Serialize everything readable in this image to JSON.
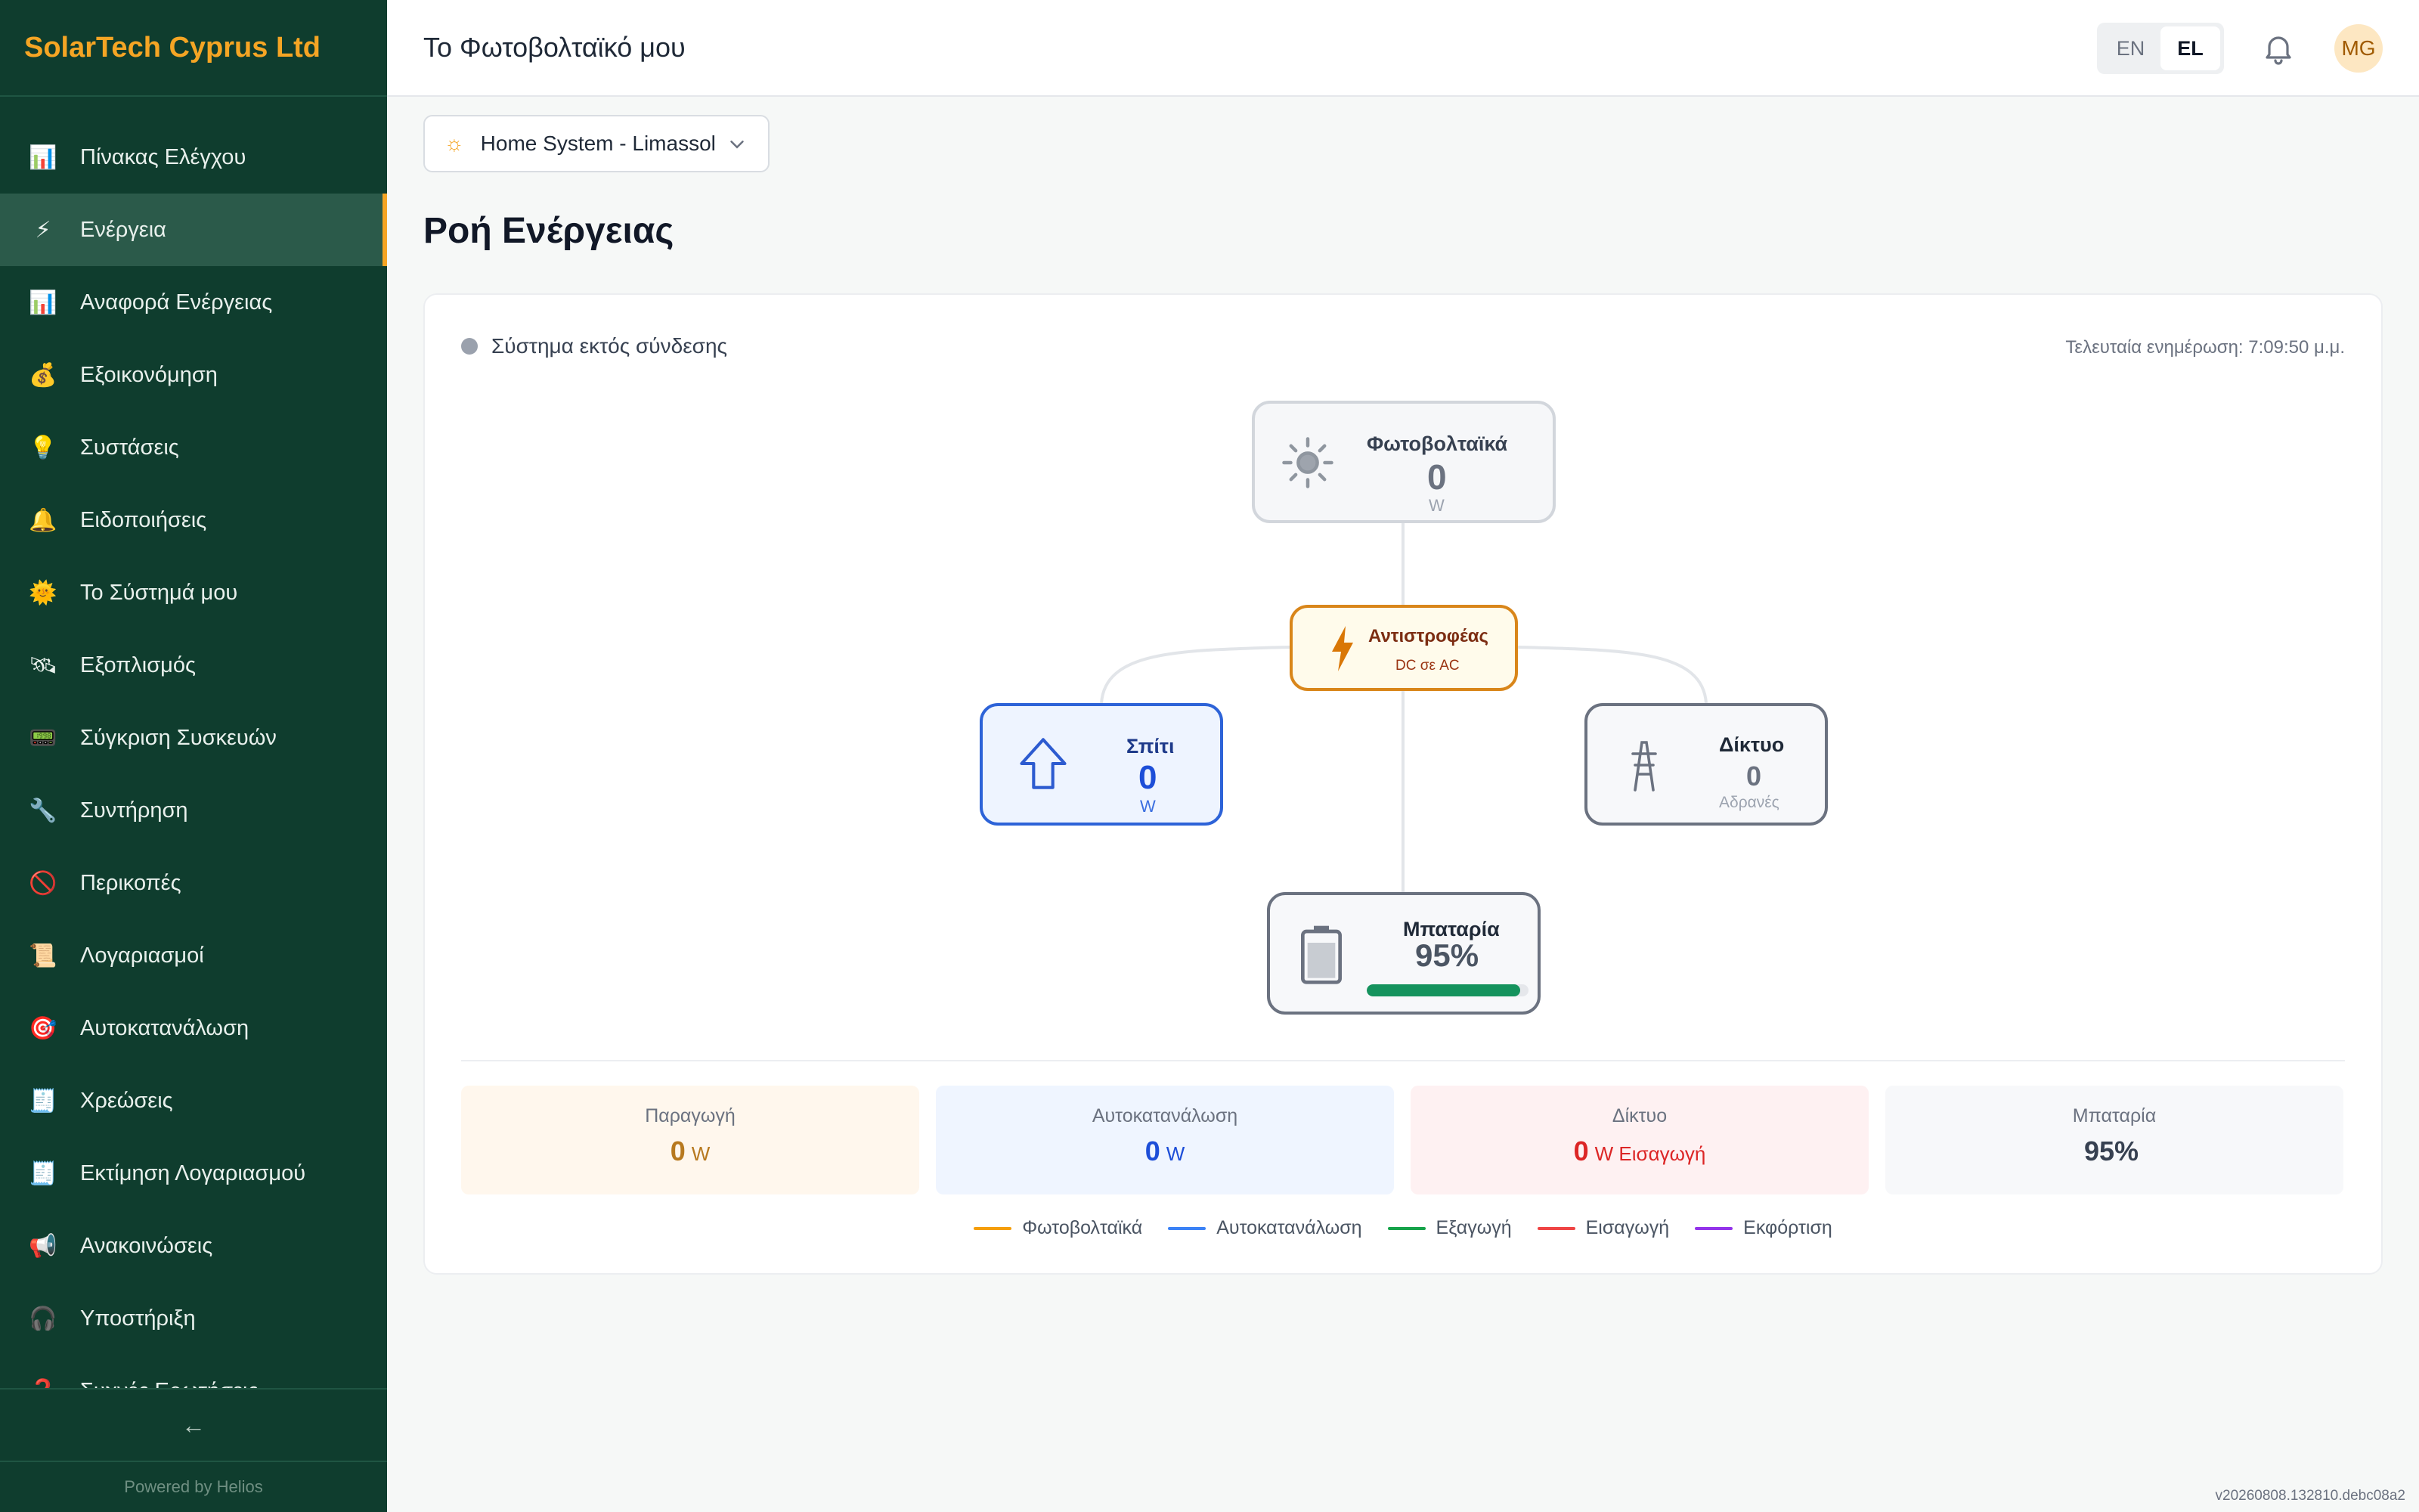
{
  "brand": "SolarTech Cyprus Ltd",
  "sidebar": {
    "items": [
      {
        "label": "Πίνακας Ελέγχου",
        "icon": "bar-chart-icon",
        "glyph": "📊"
      },
      {
        "label": "Ενέργεια",
        "icon": "lightning-icon",
        "glyph": "⚡",
        "active": true
      },
      {
        "label": "Αναφορά Ενέργειας",
        "icon": "report-icon",
        "glyph": "📊"
      },
      {
        "label": "Εξοικονόμηση",
        "icon": "money-bag-icon",
        "glyph": "💰"
      },
      {
        "label": "Συστάσεις",
        "icon": "lightbulb-icon",
        "glyph": "💡"
      },
      {
        "label": "Ειδοποιήσεις",
        "icon": "bell-icon",
        "glyph": "🔔"
      },
      {
        "label": "Το Σύστημά μου",
        "icon": "sun-icon",
        "glyph": "🌞"
      },
      {
        "label": "Εξοπλισμός",
        "icon": "satellite-icon",
        "glyph": "🛰"
      },
      {
        "label": "Σύγκριση Συσκευών",
        "icon": "device-icon",
        "glyph": "📟"
      },
      {
        "label": "Συντήρηση",
        "icon": "wrench-icon",
        "glyph": "🔧"
      },
      {
        "label": "Περικοπές",
        "icon": "prohibited-icon",
        "glyph": "🚫"
      },
      {
        "label": "Λογαριασμοί",
        "icon": "scroll-icon",
        "glyph": "📜"
      },
      {
        "label": "Αυτοκατανάλωση",
        "icon": "target-icon",
        "glyph": "🎯"
      },
      {
        "label": "Χρεώσεις",
        "icon": "receipt-icon",
        "glyph": "🧾"
      },
      {
        "label": "Εκτίμηση Λογαριασμού",
        "icon": "receipt-icon",
        "glyph": "🧾"
      },
      {
        "label": "Ανακοινώσεις",
        "icon": "megaphone-icon",
        "glyph": "📢"
      },
      {
        "label": "Υποστήριξη",
        "icon": "headphones-icon",
        "glyph": "🎧"
      },
      {
        "label": "Συχνές Ερωτήσεις",
        "icon": "question-icon",
        "glyph": "❓"
      }
    ],
    "collapse_label": "←",
    "powered_by": "Powered by Helios"
  },
  "header": {
    "title": "Το Φωτοβολταϊκό μου",
    "lang_en": "EN",
    "lang_el": "EL",
    "active_lang": "EL",
    "avatar_initials": "MG"
  },
  "system_select": {
    "value": "Home System - Limassol"
  },
  "page_title": "Ροή Ενέργειας",
  "flow": {
    "status_text": "Σύστημα εκτός σύνδεσης",
    "updated_text": "Τελευταία ενημέρωση: 7:09:50 μ.μ.",
    "pv": {
      "label": "Φωτοβολταϊκά",
      "value": "0",
      "unit": "W"
    },
    "inverter": {
      "label": "Αντιστροφέας",
      "sub": "DC σε AC"
    },
    "home": {
      "label": "Σπίτι",
      "value": "0",
      "unit": "W"
    },
    "grid": {
      "label": "Δίκτυο",
      "value": "0",
      "sub": "Αδρανές"
    },
    "battery": {
      "label": "Μπαταρία",
      "value": "95%",
      "level": 0.95
    }
  },
  "stats": [
    {
      "label": "Παραγωγή",
      "value": "0",
      "unit": "W",
      "color": "#b7791f",
      "bg": "#fff7ed"
    },
    {
      "label": "Αυτοκατανάλωση",
      "value": "0",
      "unit": "W",
      "color": "#1d4ed8",
      "bg": "#eff5ff"
    },
    {
      "label": "Δίκτυο",
      "value": "0",
      "unit": "W Εισαγωγή",
      "color": "#dc2626",
      "bg": "#fef1f2"
    },
    {
      "label": "Μπαταρία",
      "value": "95%",
      "unit": "",
      "color": "#374151",
      "bg": "#f7f8fa"
    }
  ],
  "legend": [
    {
      "label": "Φωτοβολταϊκά",
      "color": "#f59e0b"
    },
    {
      "label": "Αυτοκατανάλωση",
      "color": "#3b82f6"
    },
    {
      "label": "Εξαγωγή",
      "color": "#16a34a"
    },
    {
      "label": "Εισαγωγή",
      "color": "#ef4444"
    },
    {
      "label": "Εκφόρτιση",
      "color": "#9333ea"
    }
  ],
  "version": "v20260808.132810.debc08a2"
}
